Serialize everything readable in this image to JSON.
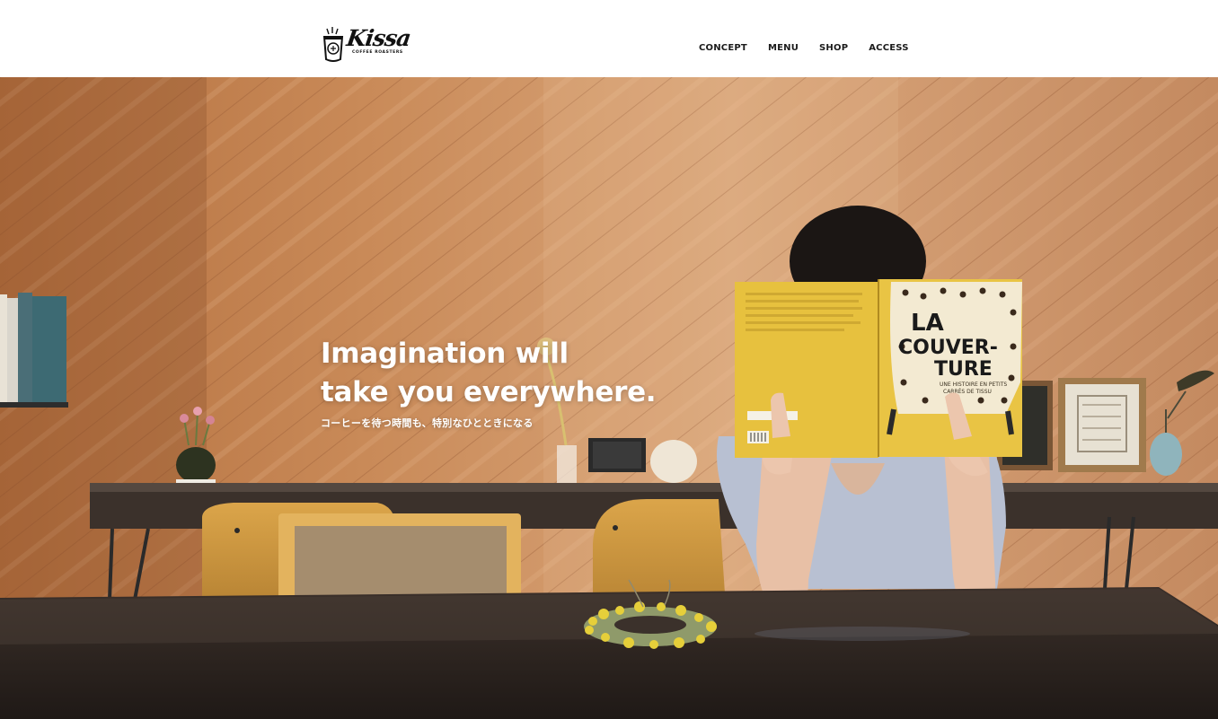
{
  "brand": {
    "name": "Kissa",
    "tagline": "COFFEE ROASTERS"
  },
  "nav": {
    "items": [
      {
        "label": "CONCEPT"
      },
      {
        "label": "MENU"
      },
      {
        "label": "SHOP"
      },
      {
        "label": "ACCESS"
      }
    ]
  },
  "hero": {
    "title_line1": "Imagination will",
    "title_line2": "take you everywhere.",
    "subtitle": "コーヒーを待つ時間も、特別なひとときになる",
    "book": {
      "title_line1": "LA",
      "title_line2": "COUVER-",
      "title_line3": "TURE",
      "subtitle_line1": "UNE HISTOIRE EN PETITS",
      "subtitle_line2": "CARRÉS DE TISSU"
    }
  },
  "colors": {
    "header_bg": "#ffffff",
    "nav_text": "#1b1b1b",
    "hero_text": "#ffffff",
    "wood_wall": "#c98d5c",
    "table": "#2e2520",
    "book_yellow": "#e7c13e"
  }
}
